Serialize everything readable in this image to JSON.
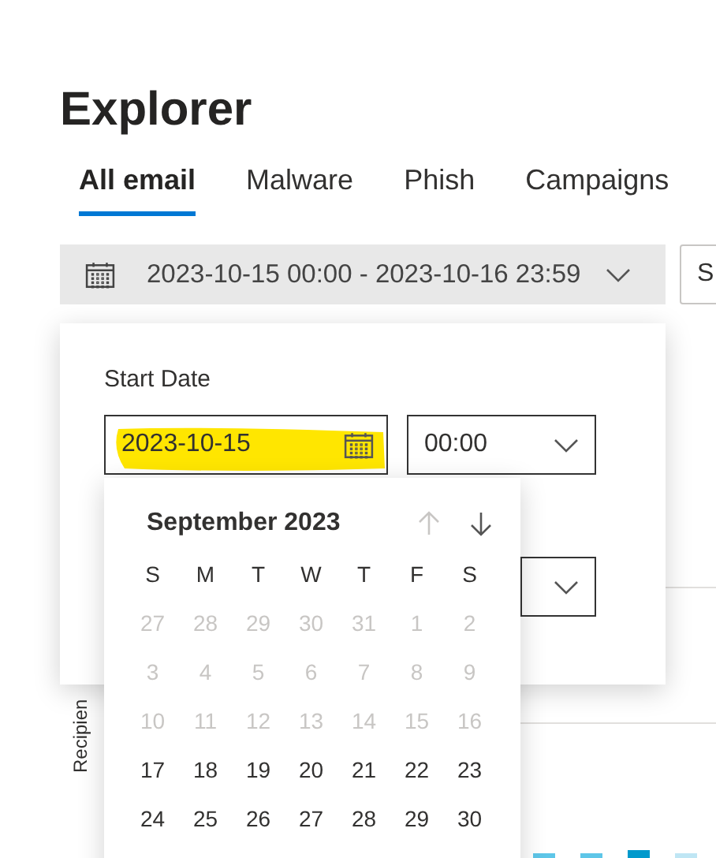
{
  "title": "Explorer",
  "tabs": [
    {
      "label": "All email",
      "selected": true
    },
    {
      "label": "Malware",
      "selected": false
    },
    {
      "label": "Phish",
      "selected": false
    },
    {
      "label": "Campaigns",
      "selected": false
    }
  ],
  "date_range": {
    "value": "2023-10-15 00:00 - 2023-10-16 23:59"
  },
  "side_field": {
    "value": "S"
  },
  "axis_label": "Recipien",
  "panel": {
    "label": "Start Date",
    "date_value": "2023-10-15",
    "time_value": "00:00"
  },
  "calendar": {
    "month": "September 2023",
    "prev_disabled": true,
    "next_disabled": false,
    "weekdays": [
      "S",
      "M",
      "T",
      "W",
      "T",
      "F",
      "S"
    ],
    "weeks": [
      [
        {
          "day": "27",
          "muted": true
        },
        {
          "day": "28",
          "muted": true
        },
        {
          "day": "29",
          "muted": true
        },
        {
          "day": "30",
          "muted": true
        },
        {
          "day": "31",
          "muted": true
        },
        {
          "day": "1",
          "muted": true
        },
        {
          "day": "2",
          "muted": true
        }
      ],
      [
        {
          "day": "3",
          "muted": true
        },
        {
          "day": "4",
          "muted": true
        },
        {
          "day": "5",
          "muted": true
        },
        {
          "day": "6",
          "muted": true
        },
        {
          "day": "7",
          "muted": true
        },
        {
          "day": "8",
          "muted": true
        },
        {
          "day": "9",
          "muted": true
        }
      ],
      [
        {
          "day": "10",
          "muted": true
        },
        {
          "day": "11",
          "muted": true
        },
        {
          "day": "12",
          "muted": true
        },
        {
          "day": "13",
          "muted": true
        },
        {
          "day": "14",
          "muted": true
        },
        {
          "day": "15",
          "muted": true
        },
        {
          "day": "16",
          "muted": true
        }
      ],
      [
        {
          "day": "17",
          "muted": false
        },
        {
          "day": "18",
          "muted": false
        },
        {
          "day": "19",
          "muted": false
        },
        {
          "day": "20",
          "muted": false
        },
        {
          "day": "21",
          "muted": false
        },
        {
          "day": "22",
          "muted": false
        },
        {
          "day": "23",
          "muted": false
        }
      ],
      [
        {
          "day": "24",
          "muted": false
        },
        {
          "day": "25",
          "muted": false
        },
        {
          "day": "26",
          "muted": false
        },
        {
          "day": "27",
          "muted": false
        },
        {
          "day": "28",
          "muted": false
        },
        {
          "day": "29",
          "muted": false
        },
        {
          "day": "30",
          "muted": false
        }
      ]
    ]
  }
}
